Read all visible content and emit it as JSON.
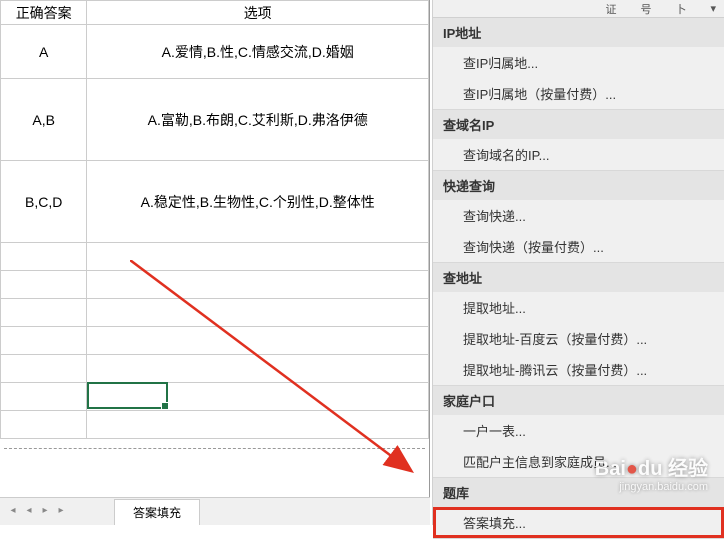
{
  "sheet": {
    "headers": [
      "正确答案",
      "选项"
    ],
    "rows": [
      {
        "answer": "A",
        "options": "A.爱情,B.性,C.情感交流,D.婚姻"
      },
      {
        "answer": "A,B",
        "options": "A.富勒,B.布朗,C.艾利斯,D.弗洛伊德"
      },
      {
        "answer": "B,C,D",
        "options": "A.稳定性,B.生物性,C.个别性,D.整体性"
      }
    ],
    "tab_name": "答案填充"
  },
  "toolbar": {
    "items": [
      "证",
      "号",
      "卜"
    ]
  },
  "menu": {
    "sections": [
      {
        "title": "IP地址",
        "items": [
          "查IP归属地...",
          "查IP归属地（按量付费）..."
        ]
      },
      {
        "title": "查域名IP",
        "items": [
          "查询域名的IP..."
        ]
      },
      {
        "title": "快递查询",
        "items": [
          "查询快递...",
          "查询快递（按量付费）..."
        ]
      },
      {
        "title": "查地址",
        "items": [
          "提取地址...",
          "提取地址-百度云（按量付费）...",
          "提取地址-腾讯云（按量付费）..."
        ]
      },
      {
        "title": "家庭户口",
        "items": [
          "一户一表...",
          "匹配户主信息到家庭成员..."
        ]
      },
      {
        "title": "题库",
        "items": [
          "答案填充..."
        ]
      }
    ]
  },
  "watermark": {
    "brand_prefix": "Bai",
    "brand_suffix": "du",
    "brand_cn": "经验",
    "url": "jingyan.baidu.com"
  }
}
